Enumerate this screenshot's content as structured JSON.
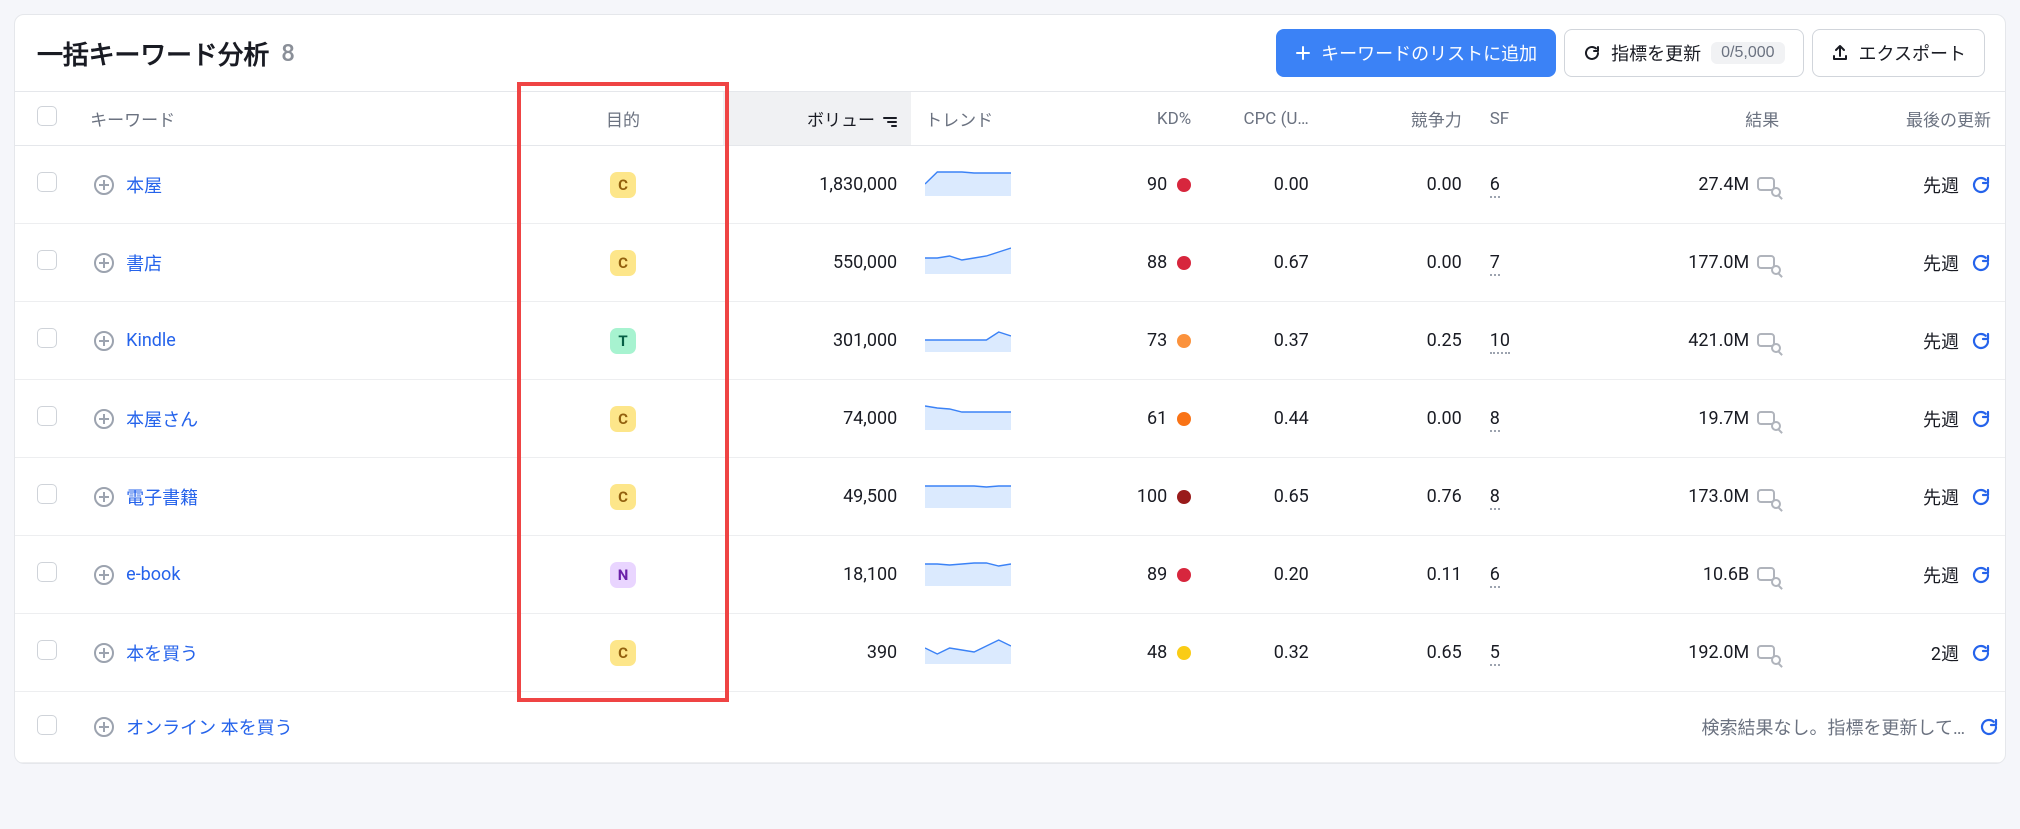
{
  "header": {
    "title": "一括キーワード分析",
    "count": "8",
    "add_button": "キーワードのリストに追加",
    "update_button": "指標を更新",
    "update_pill": "0/5,000",
    "export_button": "エクスポート"
  },
  "columns": {
    "keyword": "キーワード",
    "intent": "目的",
    "volume": "ボリュー",
    "trend": "トレンド",
    "kd": "KD%",
    "cpc": "CPC (U…",
    "comp": "競争力",
    "sf": "SF",
    "results": "結果",
    "updated": "最後の更新"
  },
  "rows": [
    {
      "keyword": "本屋",
      "intent": "C",
      "volume": "1,830,000",
      "kd": "90",
      "kd_dot": "dot-red",
      "cpc": "0.00",
      "comp": "0.00",
      "sf": "6",
      "results": "27.4M",
      "updated": "先週",
      "trend": [
        12,
        24,
        24,
        24,
        23,
        23,
        23,
        23
      ]
    },
    {
      "keyword": "書店",
      "intent": "C",
      "volume": "550,000",
      "kd": "88",
      "kd_dot": "dot-red",
      "cpc": "0.67",
      "comp": "0.00",
      "sf": "7",
      "results": "177.0M",
      "updated": "先週",
      "trend": [
        16,
        16,
        18,
        14,
        16,
        18,
        22,
        26
      ]
    },
    {
      "keyword": "Kindle",
      "intent": "T",
      "volume": "301,000",
      "kd": "73",
      "kd_dot": "dot-orange-light",
      "cpc": "0.37",
      "comp": "0.25",
      "sf": "10",
      "results": "421.0M",
      "updated": "先週",
      "trend": [
        12,
        12,
        12,
        12,
        12,
        12,
        20,
        16
      ]
    },
    {
      "keyword": "本屋さん",
      "intent": "C",
      "volume": "74,000",
      "kd": "61",
      "kd_dot": "dot-orange",
      "cpc": "0.44",
      "comp": "0.00",
      "sf": "8",
      "results": "19.7M",
      "updated": "先週",
      "trend": [
        24,
        22,
        21,
        18,
        18,
        18,
        18,
        18
      ]
    },
    {
      "keyword": "電子書籍",
      "intent": "C",
      "volume": "49,500",
      "kd": "100",
      "kd_dot": "dot-dark-red",
      "cpc": "0.65",
      "comp": "0.76",
      "sf": "8",
      "results": "173.0M",
      "updated": "先週",
      "trend": [
        22,
        22,
        22,
        22,
        22,
        21,
        22,
        22
      ]
    },
    {
      "keyword": "e-book",
      "intent": "N",
      "volume": "18,100",
      "kd": "89",
      "kd_dot": "dot-red",
      "cpc": "0.20",
      "comp": "0.11",
      "sf": "6",
      "results": "10.6B",
      "updated": "先週",
      "trend": [
        22,
        22,
        21,
        22,
        23,
        23,
        20,
        22
      ]
    },
    {
      "keyword": "本を買う",
      "intent": "C",
      "volume": "390",
      "kd": "48",
      "kd_dot": "dot-yellow",
      "cpc": "0.32",
      "comp": "0.65",
      "sf": "5",
      "results": "192.0M",
      "updated": "2週",
      "trend": [
        16,
        10,
        16,
        14,
        12,
        18,
        24,
        18
      ]
    }
  ],
  "empty_row": {
    "keyword": "オンライン 本を買う",
    "message": "検索結果なし。指標を更新して…"
  }
}
